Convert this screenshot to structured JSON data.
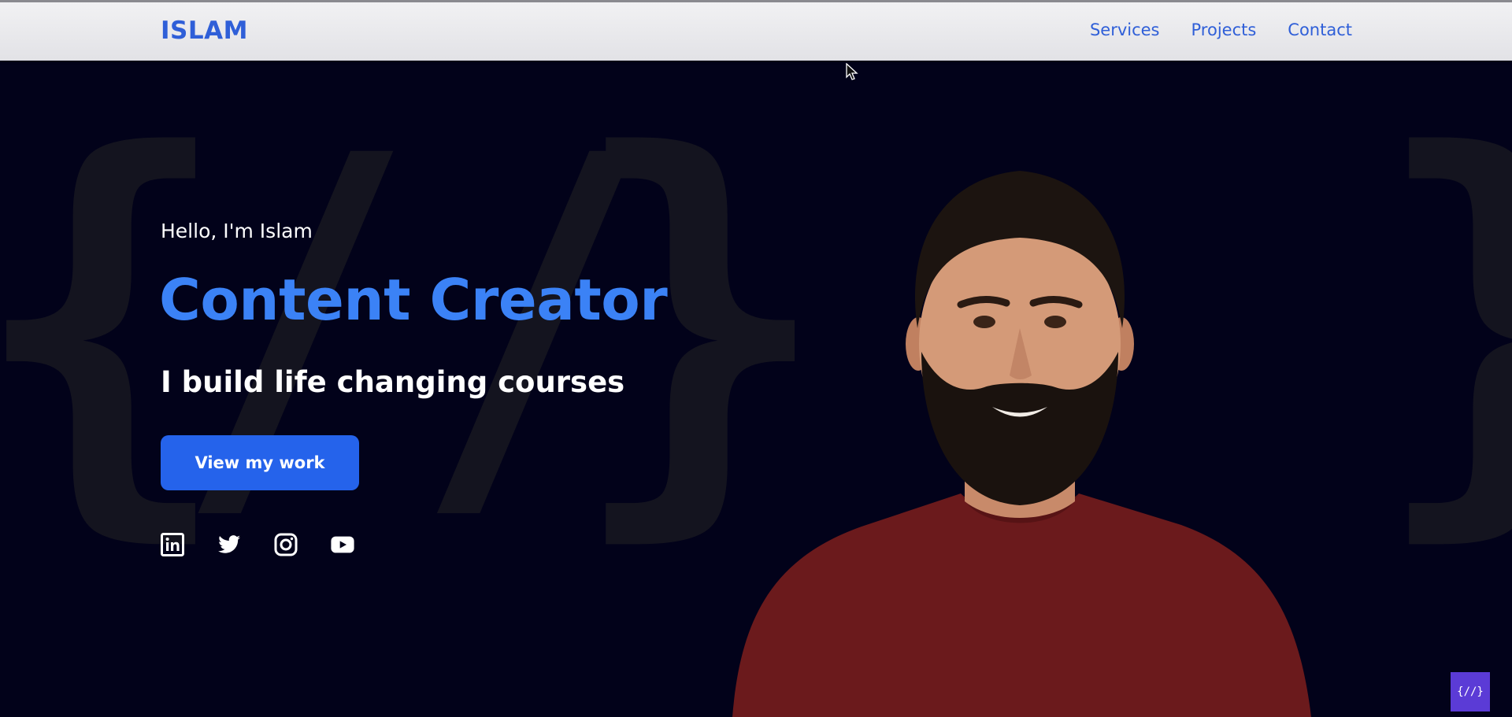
{
  "brand": {
    "logo_text": "ISLAM",
    "accent": "#2f5fd8"
  },
  "nav": {
    "items": [
      {
        "label": "Services"
      },
      {
        "label": "Projects"
      },
      {
        "label": "Contact"
      }
    ]
  },
  "hero": {
    "greeting": "Hello, I'm Islam",
    "title": "Content Creator",
    "subtitle": "I build life changing courses",
    "cta_label": "View my work",
    "title_color": "#3b82f6",
    "button_color": "#2563eb",
    "background_color": "#02021a",
    "background_glyphs": [
      "{",
      "//",
      "}"
    ]
  },
  "socials": {
    "icons": [
      "linkedin-icon",
      "twitter-icon",
      "instagram-icon",
      "youtube-icon"
    ]
  },
  "badge": {
    "text": "{//}"
  }
}
